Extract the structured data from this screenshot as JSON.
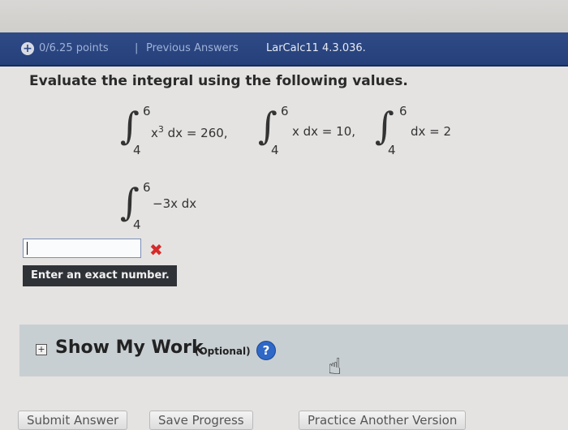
{
  "header": {
    "points": "0/6.25 points",
    "separator": "|",
    "previous_answers": "Previous Answers",
    "problem_code": "LarCalc11 4.3.036."
  },
  "question": {
    "prompt": "Evaluate the integral using the following values."
  },
  "given_integrals": [
    {
      "upper": "6",
      "lower": "4",
      "integrand_base": "x",
      "integrand_exp": "3",
      "rest": " dx = 260,"
    },
    {
      "upper": "6",
      "lower": "4",
      "integrand_base": "",
      "integrand_exp": "",
      "rest": "x dx = 10,"
    },
    {
      "upper": "6",
      "lower": "4",
      "integrand_base": "",
      "integrand_exp": "",
      "rest": "dx = 2"
    }
  ],
  "target_integral": {
    "upper": "6",
    "lower": "4",
    "expression": "−3x dx"
  },
  "answer": {
    "value": "",
    "status": "incorrect",
    "hint": "Enter an exact number."
  },
  "show_work": {
    "label": "Show My Work",
    "optional": "(Optional)",
    "help_symbol": "?"
  },
  "buttons": {
    "submit": "Submit Answer",
    "save": "Save Progress",
    "practice": "Practice Another Version"
  },
  "icons": {
    "header_plus": "plus-circle-icon",
    "wrong": "x-mark-icon",
    "expand": "plus-box-icon",
    "help": "help-icon",
    "cursor": "hand-pointer-icon"
  },
  "colors": {
    "header_bg": "#2f4a86",
    "wrong_mark": "#d62a2a",
    "tooltip_bg": "#2f3237",
    "help_blue": "#2f68c6"
  }
}
